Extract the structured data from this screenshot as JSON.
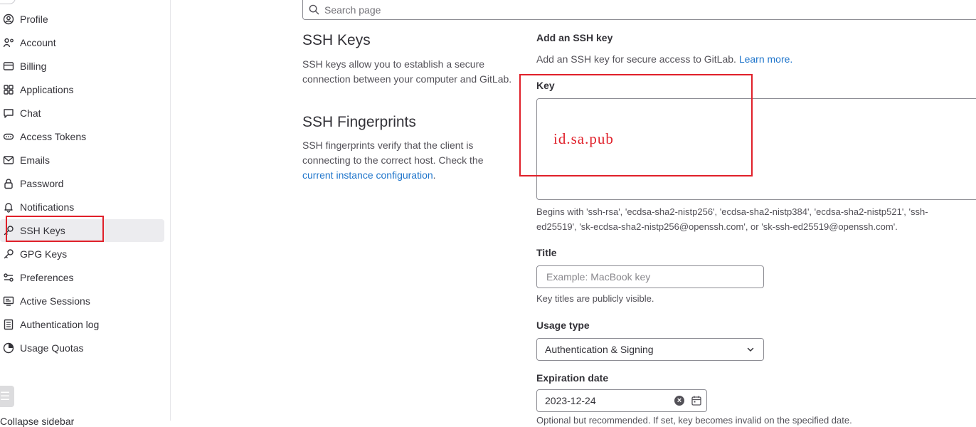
{
  "sidebar": {
    "items": [
      {
        "label": "Profile",
        "icon": "profile-icon"
      },
      {
        "label": "Account",
        "icon": "account-icon"
      },
      {
        "label": "Billing",
        "icon": "billing-icon"
      },
      {
        "label": "Applications",
        "icon": "applications-icon"
      },
      {
        "label": "Chat",
        "icon": "chat-icon"
      },
      {
        "label": "Access Tokens",
        "icon": "token-icon"
      },
      {
        "label": "Emails",
        "icon": "mail-icon"
      },
      {
        "label": "Password",
        "icon": "lock-icon"
      },
      {
        "label": "Notifications",
        "icon": "bell-icon"
      },
      {
        "label": "SSH Keys",
        "icon": "key-icon",
        "active": true
      },
      {
        "label": "GPG Keys",
        "icon": "key-icon"
      },
      {
        "label": "Preferences",
        "icon": "preferences-icon"
      },
      {
        "label": "Active Sessions",
        "icon": "monitor-icon"
      },
      {
        "label": "Authentication log",
        "icon": "log-icon"
      },
      {
        "label": "Usage Quotas",
        "icon": "quota-icon"
      }
    ],
    "collapse_label": "Collapse sidebar"
  },
  "search": {
    "placeholder": "Search page"
  },
  "ssh_keys_section": {
    "title": "SSH Keys",
    "description": "SSH keys allow you to establish a secure connection between your computer and GitLab."
  },
  "fingerprints_section": {
    "title": "SSH Fingerprints",
    "description": "SSH fingerprints verify that the client is connecting to the correct host. Check the",
    "link_text": "current instance configuration",
    "suffix": "."
  },
  "form": {
    "heading": "Add an SSH key",
    "intro": "Add an SSH key for secure access to GitLab.",
    "learn_more": "Learn more.",
    "key_label": "Key",
    "key_annotation": "id.sa.pub",
    "key_help": "Begins with 'ssh-rsa', 'ecdsa-sha2-nistp256', 'ecdsa-sha2-nistp384', 'ecdsa-sha2-nistp521', 'ssh-ed25519', 'sk-ecdsa-sha2-nistp256@openssh.com', or 'sk-ssh-ed25519@openssh.com'.",
    "title_label": "Title",
    "title_placeholder": "Example: MacBook key",
    "title_help": "Key titles are publicly visible.",
    "usage_label": "Usage type",
    "usage_value": "Authentication & Signing",
    "expiration_label": "Expiration date",
    "expiration_value": "2023-12-24",
    "expiration_help": "Optional but recommended. If set, key becomes invalid on the specified date."
  },
  "colors": {
    "accent": "#1f75cb",
    "annotation": "#e0202a",
    "active_bg": "#ececef"
  }
}
